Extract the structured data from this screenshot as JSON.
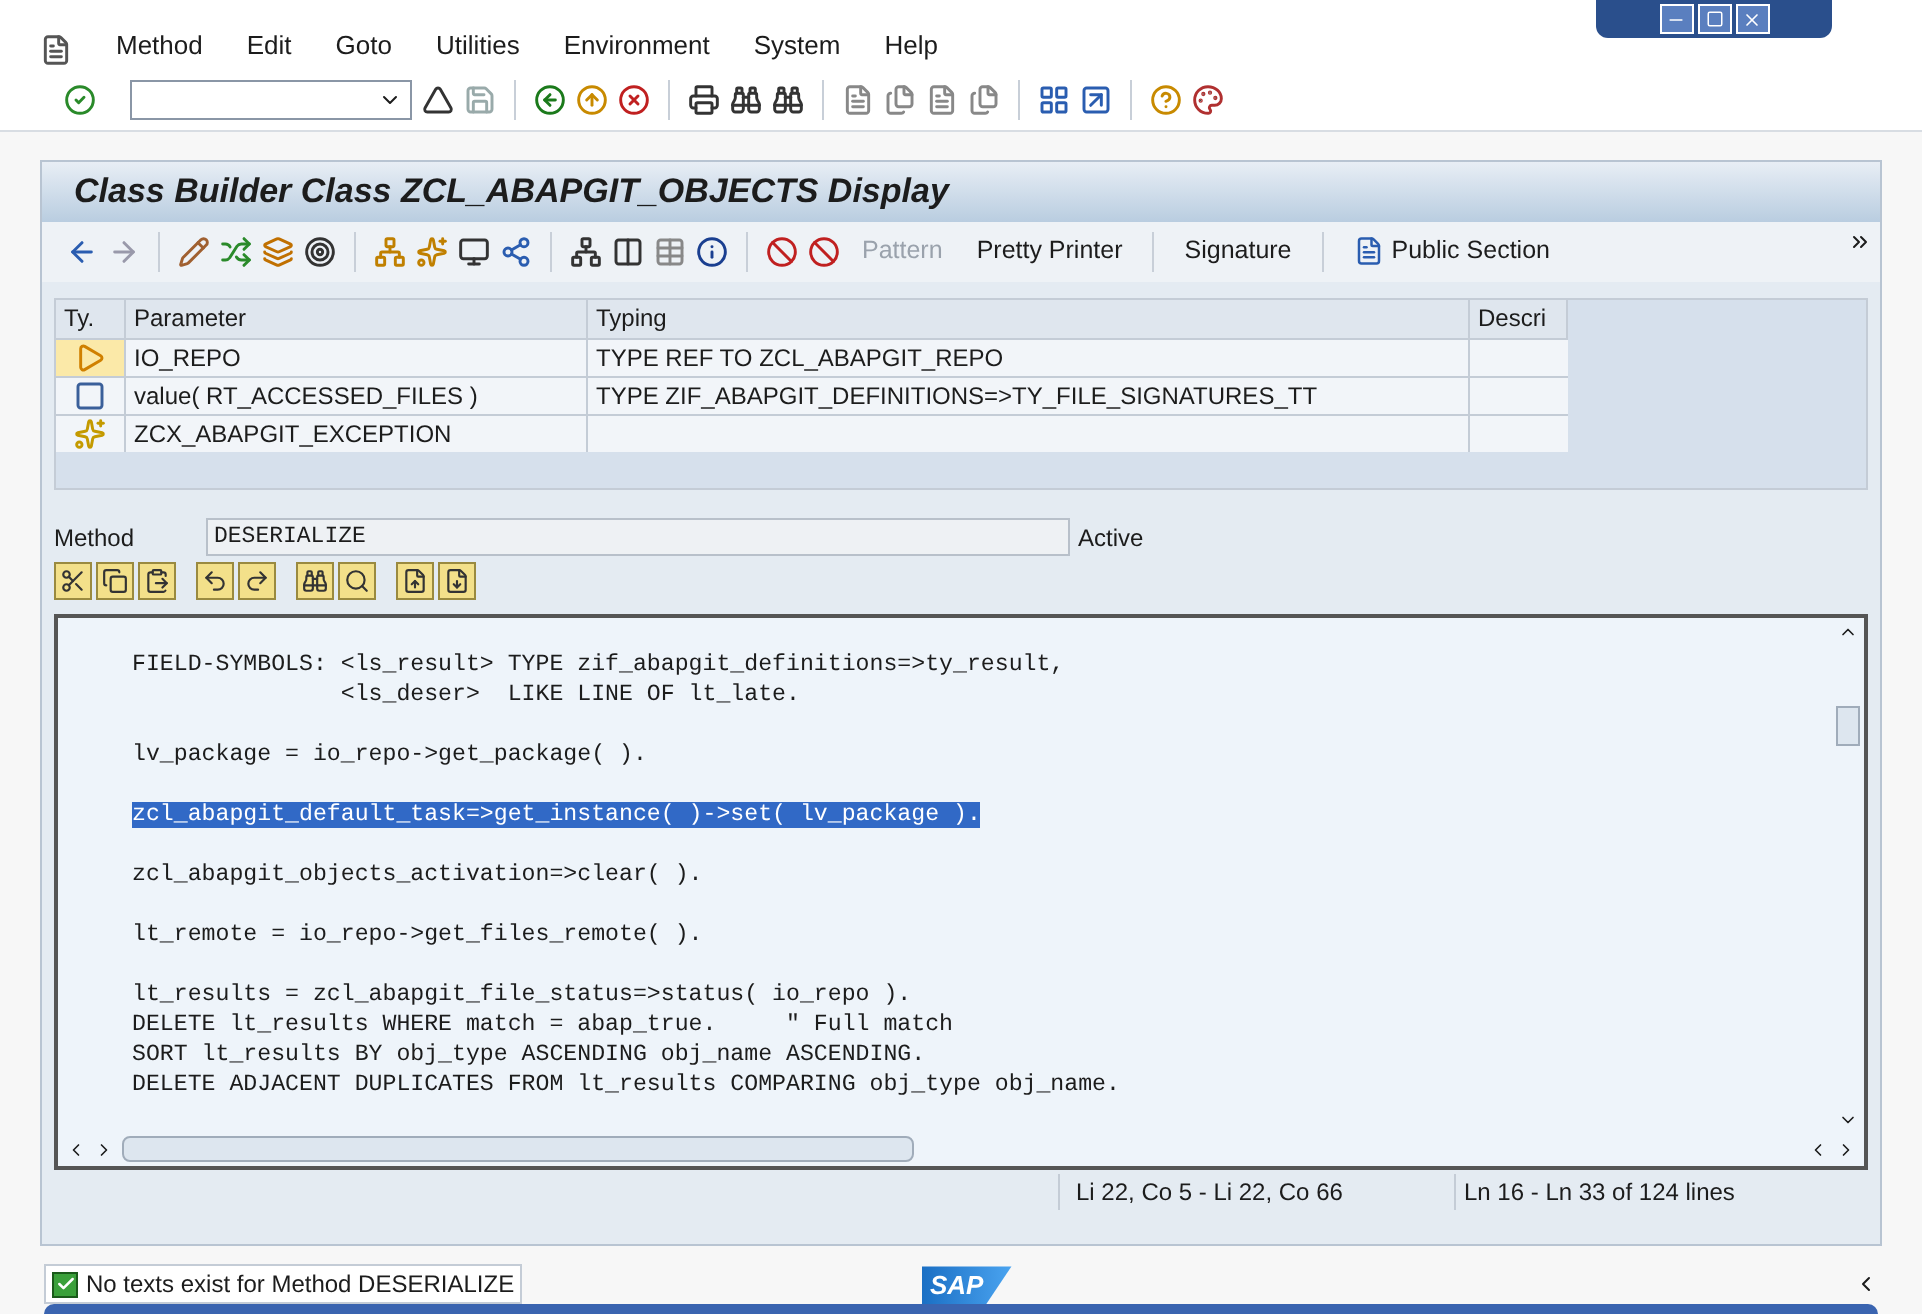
{
  "menu": [
    {
      "label": "Method"
    },
    {
      "label": "Edit"
    },
    {
      "label": "Goto"
    },
    {
      "label": "Utilities"
    },
    {
      "label": "Environment"
    },
    {
      "label": "System"
    },
    {
      "label": "Help"
    }
  ],
  "title": "Class Builder Class ZCL_ABAPGIT_OBJECTS Display",
  "app_toolbar": [
    {
      "label": "Pattern",
      "disabled": true,
      "kind": "text"
    },
    {
      "label": "Pretty Printer",
      "disabled": false,
      "kind": "text"
    },
    {
      "label": "Signature",
      "disabled": false,
      "kind": "text"
    },
    {
      "label": "Public Section",
      "disabled": false,
      "kind": "icon_text"
    }
  ],
  "params": {
    "columns": [
      "Ty.",
      "Parameter",
      "Typing",
      "Descri"
    ],
    "rows": [
      {
        "kind": "importing",
        "selected": true,
        "parameter": "IO_REPO",
        "typing": "TYPE REF TO ZCL_ABAPGIT_REPO"
      },
      {
        "kind": "returning",
        "selected": false,
        "parameter": "value( RT_ACCESSED_FILES )",
        "typing": "TYPE ZIF_ABAPGIT_DEFINITIONS=>TY_FILE_SIGNATURES_TT"
      },
      {
        "kind": "exception",
        "selected": false,
        "parameter": "ZCX_ABAPGIT_EXCEPTION"
      }
    ]
  },
  "method": {
    "label": "Method",
    "value": "DESERIALIZE",
    "status": "Active"
  },
  "editor": {
    "blocks": [
      [
        {
          "text": "FIELD-SYMBOLS: <ls_result> TYPE zif_abapgit_definitions=>ty_result,",
          "selected": false
        },
        {
          "text": "               <ls_deser>  LIKE LINE OF lt_late.",
          "selected": false
        }
      ],
      [
        {
          "text": "lv_package = io_repo->get_package( ).",
          "selected": false
        }
      ],
      [
        {
          "text": "zcl_abapgit_default_task=>get_instance( )->set( lv_package ).",
          "selected": true
        }
      ],
      [
        {
          "text": "zcl_abapgit_objects_activation=>clear( ).",
          "selected": false
        }
      ],
      [
        {
          "text": "lt_remote = io_repo->get_files_remote( ).",
          "selected": false
        }
      ],
      [
        {
          "text": "lt_results = zcl_abapgit_file_status=>status( io_repo ).",
          "selected": false
        },
        {
          "text": "DELETE lt_results WHERE match = abap_true.     \" Full match",
          "selected": false
        },
        {
          "text": "SORT lt_results BY obj_type ASCENDING obj_name ASCENDING.",
          "selected": false
        },
        {
          "text": "DELETE ADJACENT DUPLICATES FROM lt_results COMPARING obj_type obj_name.",
          "selected": false
        }
      ]
    ],
    "status": [
      "Li 22, Co 5 - Li 22, Co 66",
      "Ln 16 - Ln 33 of 124 lines"
    ]
  },
  "status_bar": {
    "kind": "success",
    "message": "No texts exist for Method DESERIALIZE",
    "logo": "SAP"
  }
}
